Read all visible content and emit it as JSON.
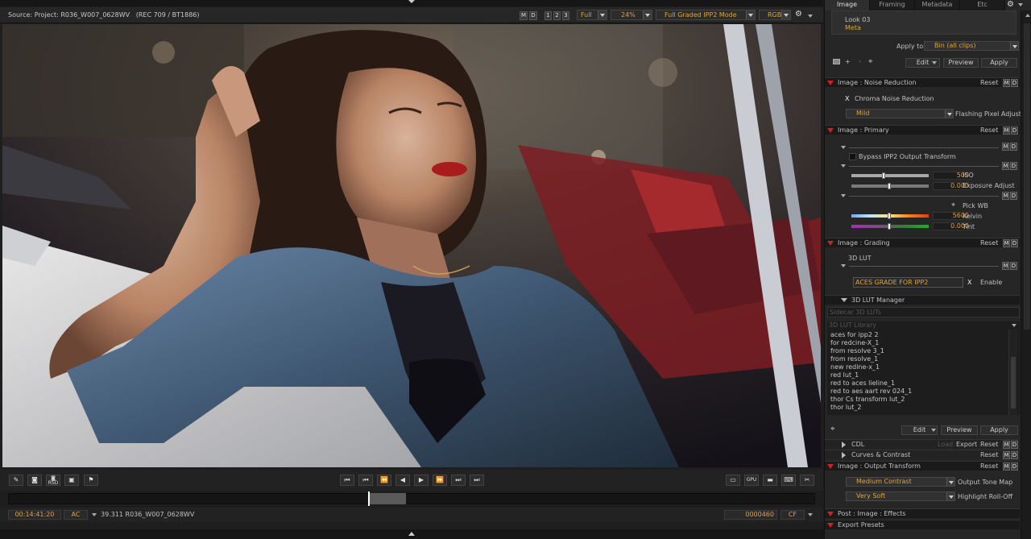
{
  "viewer": {
    "source": "Source: Project: R036_W007_0628WV",
    "colorspace": "(REC 709 / BT1886)",
    "m": "M",
    "d": "D",
    "page1": "1",
    "page2": "2",
    "page3": "3",
    "resolution": "Full",
    "zoom": "24%",
    "mode": "Full Graded IPP2 Mode",
    "channel": "RGB"
  },
  "transport": {
    "timecode": "00:14:41:20",
    "tc_mode": "AC",
    "clip": "39.311 R036_W007_0628WV",
    "frame": "0000460",
    "frame_mode": "CF",
    "rsd_label": "RSD",
    "gpu_label": "GPU"
  },
  "panel": {
    "tabs": [
      "Image",
      "Framing",
      "Metadata",
      "Etc"
    ],
    "looks": [
      "Look 03",
      "Meta"
    ],
    "apply_to_label": "Apply to:",
    "apply_to_value": "Bin (all clips)",
    "edit": "Edit",
    "preview": "Preview",
    "apply": "Apply",
    "reset": "Reset",
    "m": "M",
    "d": "D",
    "noise": {
      "title": "Image : Noise Reduction",
      "chroma_label": "Chroma Noise Reduction",
      "chroma_check": "X",
      "flashing_value": "Mild",
      "flashing_label": "Flashing Pixel Adjust"
    },
    "primary": {
      "title": "Image : Primary",
      "bypass_label": "Bypass IPP2 Output Transform",
      "iso_value": "500",
      "iso_label": "ISO",
      "exposure_value": "0.000",
      "exposure_label": "Exposure Adjust",
      "pickwb_label": "Pick WB",
      "kelvin_value": "5600",
      "kelvin_label": "Kelvin",
      "tint_value": "0.000",
      "tint_label": "Tint"
    },
    "grading": {
      "title": "Image : Grading",
      "lut_label": "3D LUT",
      "lut_value": "ACES GRADE FOR IPP2",
      "enable_x": "X",
      "enable_label": "Enable"
    },
    "lut_manager": {
      "title": "3D LUT Manager",
      "sidecar": "Sidecar 3D LUTs",
      "library": "3D LUT Library",
      "items": [
        "aces for ipp2 2",
        "for redcine-X_1",
        "from resolve 3_1",
        "from resolve_1",
        "new redine-x_1",
        "red lut_1",
        "red to aces lieline_1",
        "red to aes aart rev 024_1",
        "thor Cs transform lut_2",
        "thor lut_2"
      ]
    },
    "cdl": {
      "title": "CDL",
      "load": "Load",
      "export": "Export"
    },
    "curves": {
      "title": "Curves & Contrast"
    },
    "output": {
      "title": "Image : Output Transform",
      "tonemap_value": "Medium Contrast",
      "tonemap_label": "Output Tone Map",
      "rolloff_value": "Very Soft",
      "rolloff_label": "Highlight Roll-Off"
    },
    "post_effects": "Post : Image : Effects",
    "export_presets": "Export Presets"
  }
}
